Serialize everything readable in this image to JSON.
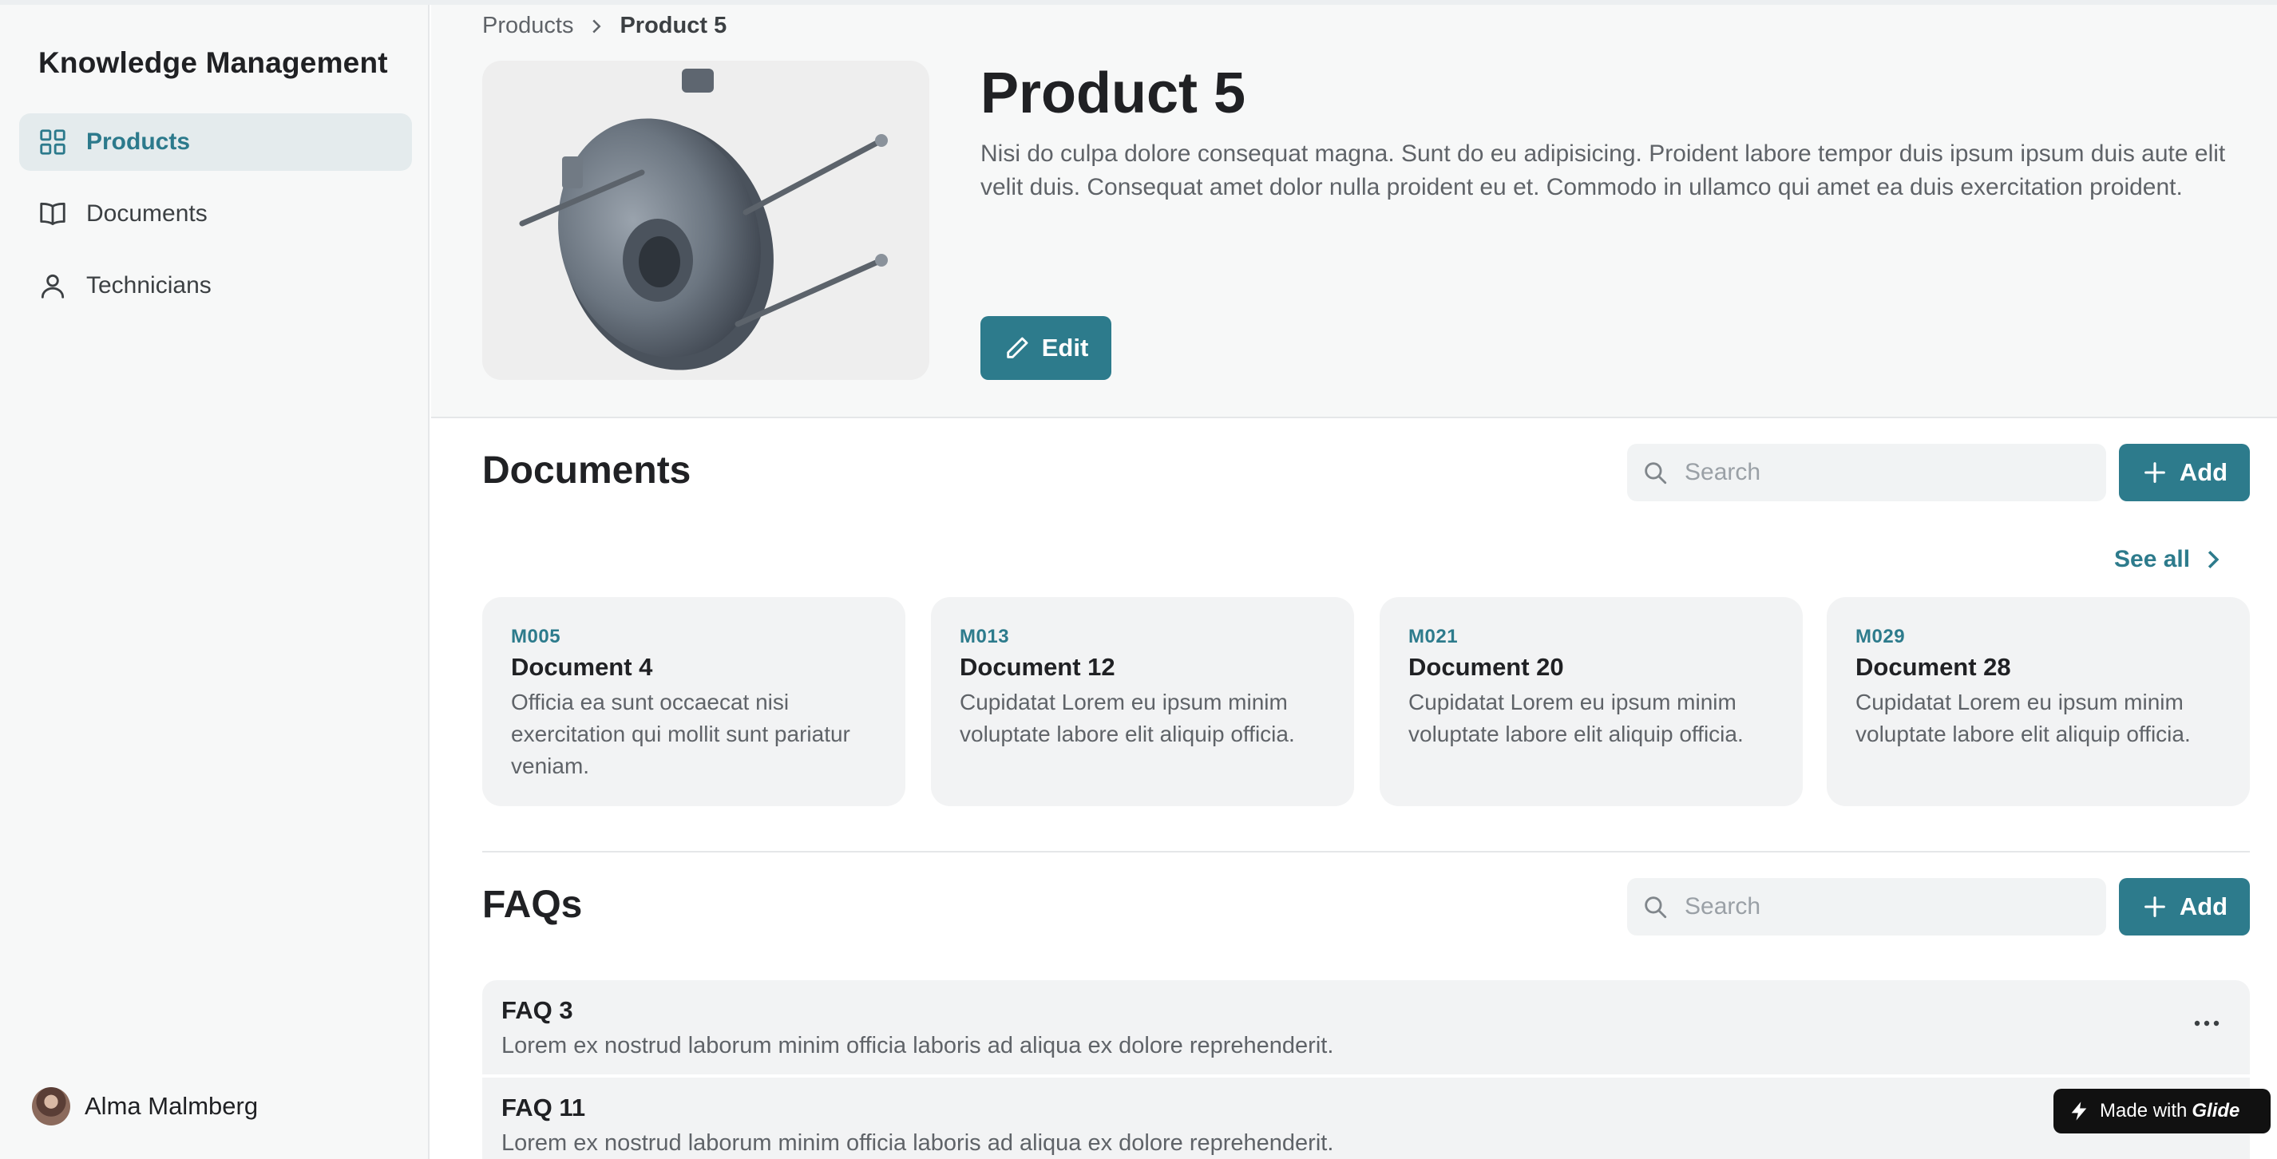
{
  "sidebar": {
    "app_title": "Knowledge Management",
    "items": [
      {
        "label": "Products",
        "icon": "grid-icon",
        "active": true
      },
      {
        "label": "Documents",
        "icon": "book-icon",
        "active": false
      },
      {
        "label": "Technicians",
        "icon": "person-icon",
        "active": false
      }
    ],
    "user": {
      "name": "Alma Malmberg"
    }
  },
  "breadcrumb": {
    "parent": "Products",
    "current": "Product 5"
  },
  "product": {
    "title": "Product 5",
    "description": "Nisi do culpa dolore consequat magna. Sunt do eu adipisicing. Proident labore tempor duis ipsum ipsum duis aute elit velit duis. Consequat amet dolor nulla proident eu et. Commodo in ullamco qui amet ea duis exercitation proident.",
    "edit_label": "Edit"
  },
  "documents": {
    "title": "Documents",
    "search_placeholder": "Search",
    "add_label": "Add",
    "see_all_label": "See all",
    "cards": [
      {
        "code": "M005",
        "title": "Document 4",
        "description": "Officia ea sunt occaecat nisi exercitation qui mollit sunt pariatur veniam."
      },
      {
        "code": "M013",
        "title": "Document 12",
        "description": "Cupidatat Lorem eu ipsum minim voluptate labore elit aliquip officia."
      },
      {
        "code": "M021",
        "title": "Document 20",
        "description": "Cupidatat Lorem eu ipsum minim voluptate labore elit aliquip officia."
      },
      {
        "code": "M029",
        "title": "Document 28",
        "description": "Cupidatat Lorem eu ipsum minim voluptate labore elit aliquip officia."
      }
    ]
  },
  "faqs": {
    "title": "FAQs",
    "search_placeholder": "Search",
    "add_label": "Add",
    "items": [
      {
        "title": "FAQ 3",
        "description": "Lorem ex nostrud laborum minim officia laboris ad aliqua ex dolore reprehenderit."
      },
      {
        "title": "FAQ 11",
        "description": "Lorem ex nostrud laborum minim officia laboris ad aliqua ex dolore reprehenderit."
      }
    ]
  },
  "badge": {
    "prefix": "Made with",
    "brand": "Glide"
  },
  "colors": {
    "accent": "#2d7b8c",
    "sidebar_bg": "#f7f8f8",
    "card_bg": "#f2f3f4"
  }
}
